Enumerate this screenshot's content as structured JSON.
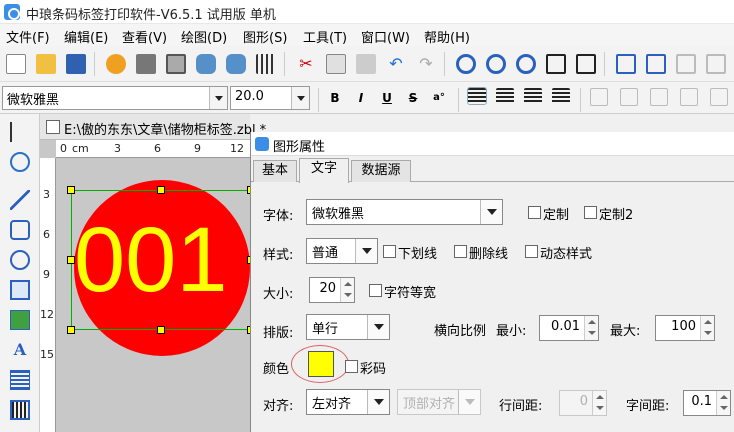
{
  "app": {
    "title": "中琅条码标签打印软件-V6.5.1 试用版 单机"
  },
  "menu": [
    "文件(F)",
    "编辑(E)",
    "查看(V)",
    "绘图(D)",
    "图形(S)",
    "工具(T)",
    "窗口(W)",
    "帮助(H)"
  ],
  "toolbar": {
    "icons": [
      "settings-icon",
      "print-icon",
      "print-preview-icon",
      "database-icon",
      "database-settings-icon",
      "grid-icon",
      "cut-icon",
      "copy-icon",
      "paste-icon",
      "undo-icon",
      "redo-icon",
      "zoom-in-icon",
      "zoom-out-icon",
      "zoom-icon",
      "fit-page-icon",
      "actual-size-icon",
      "group-icon",
      "ungroup-icon",
      "lock-icon",
      "unlock-icon"
    ]
  },
  "format_bar": {
    "font_name": "微软雅黑",
    "font_size": "20.0",
    "bold": "B",
    "italic": "I",
    "underline": "U",
    "strike": "S"
  },
  "document": {
    "tab_label": "E:\\傲的东东\\文章\\储物柜标签.zbl *",
    "ruler_h": [
      "0",
      "cm",
      "3",
      "6",
      "9",
      "12"
    ],
    "ruler_v": [
      "3",
      "6",
      "9",
      "12",
      "15"
    ],
    "label_text": "001",
    "circle_color": "#ff0000",
    "text_color": "#ffff00"
  },
  "dialog": {
    "title": "图形属性",
    "tabs": [
      "基本",
      "文字",
      "数据源"
    ],
    "active_tab": "文字",
    "font_label": "字体:",
    "font_value": "微软雅黑",
    "custom1": "定制",
    "custom2": "定制2",
    "style_label": "样式:",
    "style_value": "普通",
    "underline": "下划线",
    "strikethrough": "删除线",
    "dynamic_style": "动态样式",
    "size_label": "大小:",
    "size_value": "20",
    "char_equal_width": "字符等宽",
    "layout_label": "排版:",
    "layout_value": "单行",
    "hscale_label": "横向比例",
    "min_label": "最小:",
    "min_value": "0.01",
    "max_label": "最大:",
    "max_value": "100",
    "color_label": "颜色",
    "color_value": "#ffff00",
    "color_code": "彩码",
    "align_label": "对齐:",
    "align_value": "左对齐",
    "valign_value": "顶部对齐",
    "line_spacing_label": "行间距:",
    "line_spacing_value": "0",
    "char_spacing_label": "字间距:",
    "char_spacing_value": "0.1"
  }
}
